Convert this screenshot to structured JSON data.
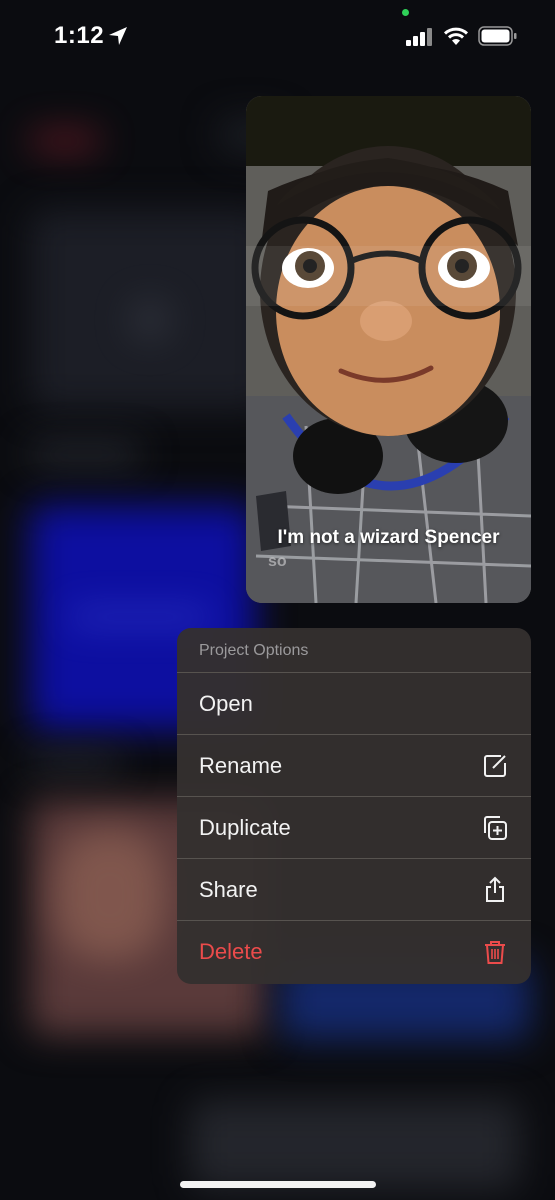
{
  "status_bar": {
    "time": "1:12",
    "location_icon": "location-arrow-icon",
    "signal_icon": "cellular-signal-icon",
    "wifi_icon": "wifi-icon",
    "battery_icon": "battery-icon",
    "privacy_dot_color": "#2fd158"
  },
  "preview": {
    "caption": "I'm not a wizard Spencer",
    "caption_sub": "so"
  },
  "context_menu": {
    "header": "Project Options",
    "items": [
      {
        "label": "Open",
        "icon": null
      },
      {
        "label": "Rename",
        "icon": "compose-icon"
      },
      {
        "label": "Duplicate",
        "icon": "duplicate-plus-icon"
      },
      {
        "label": "Share",
        "icon": "share-icon"
      },
      {
        "label": "Delete",
        "icon": "trash-icon",
        "color": "#eb4b4b"
      }
    ]
  }
}
